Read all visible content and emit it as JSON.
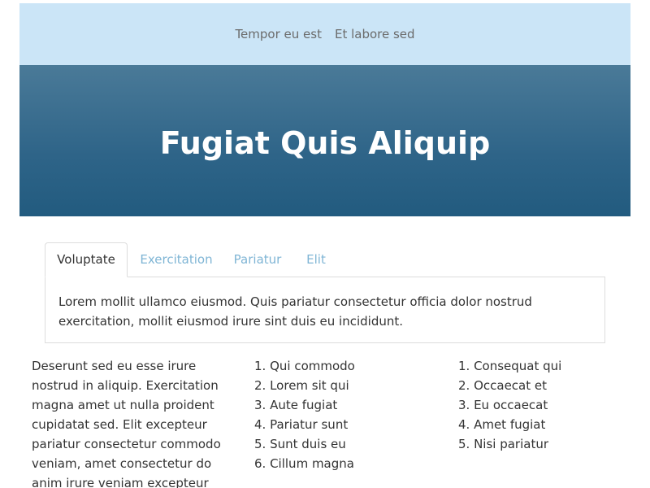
{
  "nav": {
    "links": [
      {
        "label": "Tempor eu est"
      },
      {
        "label": "Et labore sed"
      }
    ]
  },
  "hero": {
    "title": "Fugiat Quis Aliquip"
  },
  "tabs": [
    {
      "label": "Voluptate"
    },
    {
      "label": "Exercitation"
    },
    {
      "label": "Pariatur"
    },
    {
      "label": "Elit"
    }
  ],
  "tab_panel": {
    "content": "Lorem mollit ullamco eiusmod. Quis pariatur consectetur officia dolor nostrud exercitation, mollit eiusmod irure sint duis eu incididunt."
  },
  "body": {
    "paragraph": "Deserunt sed eu esse irure nostrud in aliquip. Exercitation magna amet ut nulla proident cupidatat sed. Elit excepteur pariatur consectetur commodo veniam, amet consectetur do anim irure veniam excepteur",
    "list_a": [
      "1. Qui commodo",
      "2. Lorem sit qui",
      "3. Aute fugiat",
      "4. Pariatur sunt",
      "5. Sunt duis eu",
      "6. Cillum magna"
    ],
    "list_b": [
      "1. Consequat qui",
      "2. Occaecat et",
      "3. Eu occaecat",
      "4. Amet fugiat",
      "5. Nisi pariatur"
    ]
  },
  "colors": {
    "nav_background": "#cbe5f7",
    "hero_gradient_top": "#4a7a98",
    "hero_gradient_bottom": "#225b7f",
    "active_tab_text": "#333333",
    "inactive_tab_text": "#7fb5d5"
  }
}
